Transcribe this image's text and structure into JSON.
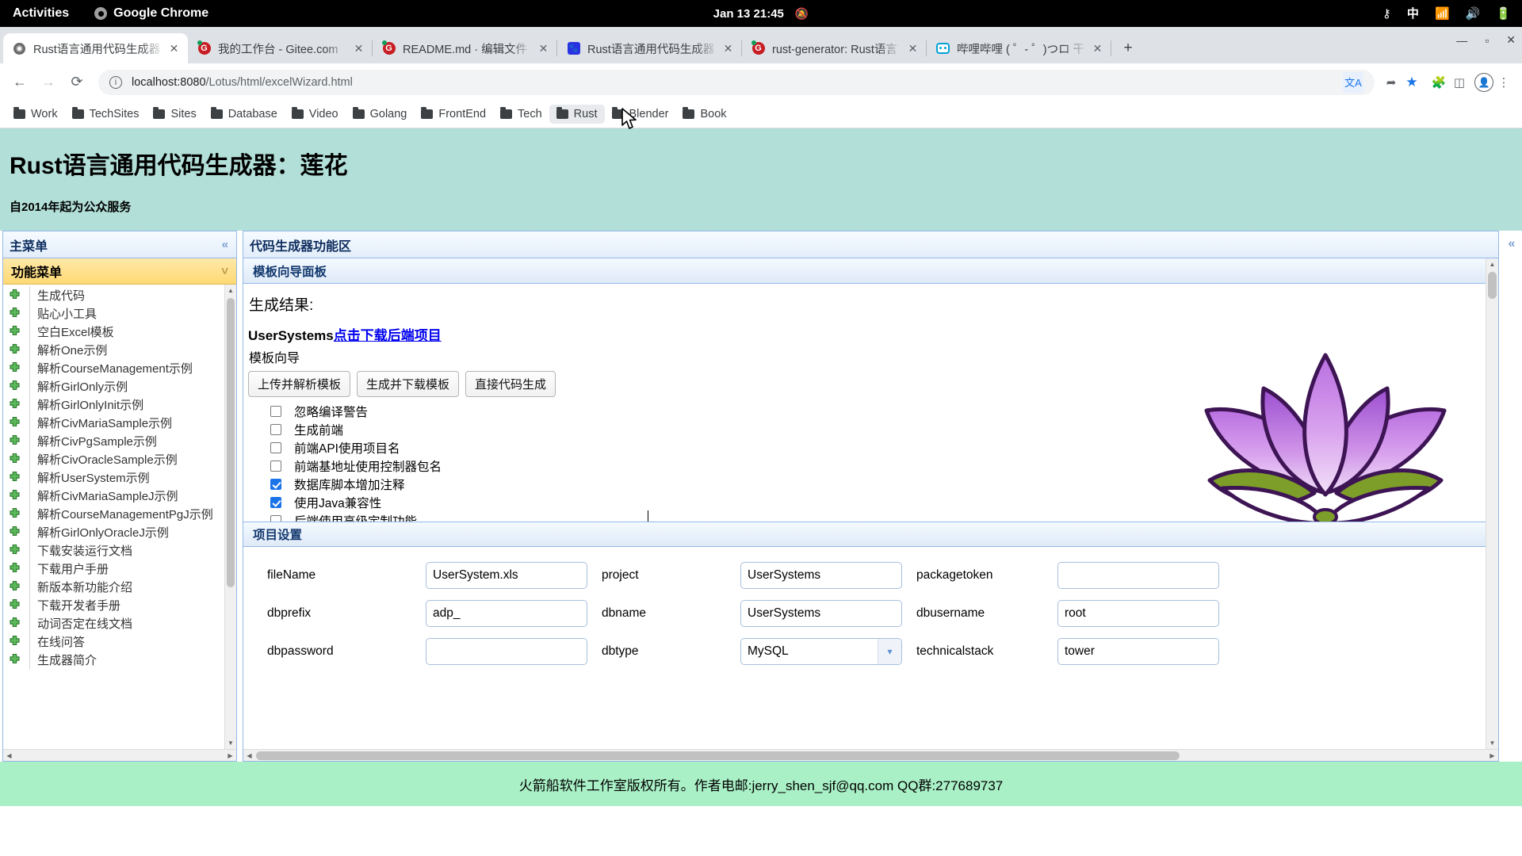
{
  "gnome": {
    "activities": "Activities",
    "app_name": "Google Chrome",
    "clock": "Jan 13  21:45",
    "notif_icon": "bell-muted-icon",
    "tray": {
      "accessibility": "accessibility-icon",
      "input_method": "中",
      "wifi": "wifi-icon",
      "volume": "volume-icon",
      "battery": "battery-charging-icon"
    }
  },
  "browser": {
    "tabs": [
      {
        "title": "Rust语言通用代码生成器",
        "favicon": "globe-icon",
        "active": true
      },
      {
        "title": "我的工作台 - Gitee.com",
        "favicon": "gitee-icon",
        "active": false
      },
      {
        "title": "README.md · 编辑文件",
        "favicon": "gitee-icon",
        "active": false
      },
      {
        "title": "Rust语言通用代码生成器",
        "favicon": "baidu-icon",
        "active": false
      },
      {
        "title": "rust-generator: Rust语言",
        "favicon": "gitee-icon",
        "active": false
      },
      {
        "title": "哔哩哔哩 ( ゜- ゜)つロ 干",
        "favicon": "bilibili-icon",
        "active": false
      }
    ],
    "new_tab_label": "+",
    "window_controls": {
      "minimize": "—",
      "maximize": "▫",
      "close": "✕"
    },
    "toolbar": {
      "back": "←",
      "forward": "→",
      "reload": "⟳",
      "url_host": "localhost:8080",
      "url_path": "/Lotus/html/excelWizard.html",
      "site_info_icon": "info-circle-icon",
      "translate_icon": "translate-icon",
      "share_icon": "share-icon",
      "bookmark_icon": "star-filled-icon",
      "extensions_icon": "puzzle-icon",
      "sidepanel_icon": "side-panel-icon",
      "profile_icon": "avatar-icon",
      "menu_icon": "three-dot-menu-icon"
    },
    "bookmarks": [
      {
        "label": "Work",
        "hovered": false
      },
      {
        "label": "TechSites",
        "hovered": false
      },
      {
        "label": "Sites",
        "hovered": false
      },
      {
        "label": "Database",
        "hovered": false
      },
      {
        "label": "Video",
        "hovered": false
      },
      {
        "label": "Golang",
        "hovered": false
      },
      {
        "label": "FrontEnd",
        "hovered": false
      },
      {
        "label": "Tech",
        "hovered": false
      },
      {
        "label": "Rust",
        "hovered": true
      },
      {
        "label": "Blender",
        "hovered": false
      },
      {
        "label": "Book",
        "hovered": false
      }
    ]
  },
  "page": {
    "title": "Rust语言通用代码生成器：莲花",
    "subtitle": "自2014年起为公众服务",
    "sidebar": {
      "header": "主菜单",
      "collapse_icon": "chevron-double-left-icon",
      "accordion_title": "功能菜单",
      "accordion_icon": "chevron-double-up-icon",
      "items": [
        "生成代码",
        "贴心小工具",
        "空白Excel模板",
        "解析One示例",
        "解析CourseManagement示例",
        "解析GirlOnly示例",
        "解析GirlOnlyInit示例",
        "解析CivMariaSample示例",
        "解析CivPgSample示例",
        "解析CivOracleSample示例",
        "解析UserSystem示例",
        "解析CivMariaSampleJ示例",
        "解析CourseManagementPgJ示例",
        "解析GirlOnlyOracleJ示例",
        "下载安装运行文档",
        "下载用户手册",
        "新版本新功能介绍",
        "下载开发者手册",
        "动词否定在线文档",
        "在线问答",
        "生成器简介"
      ]
    },
    "main": {
      "header": "代码生成器功能区",
      "wizard_panel_title": "模板向导面板",
      "gen_result_label": "生成结果:",
      "result_project": "UserSystems",
      "result_link": "点击下载后端项目",
      "wizard_label": "模板向导",
      "buttons": [
        "上传并解析模板",
        "生成并下载模板",
        "直接代码生成"
      ],
      "checkboxes": [
        {
          "label": "忽略编译警告",
          "checked": false
        },
        {
          "label": "生成前端",
          "checked": false
        },
        {
          "label": "前端API使用项目名",
          "checked": false
        },
        {
          "label": "前端基地址使用控制器包名",
          "checked": false
        },
        {
          "label": "数据库脚本增加注释",
          "checked": true
        },
        {
          "label": "使用Java兼容性",
          "checked": true
        },
        {
          "label": "后端使用高级定制功能",
          "checked": false
        }
      ],
      "settings_panel_title": "项目设置",
      "fields": [
        {
          "label": "fileName",
          "value": "UserSystem.xls",
          "type": "text"
        },
        {
          "label": "project",
          "value": "UserSystems",
          "type": "text"
        },
        {
          "label": "packagetoken",
          "value": "",
          "type": "text"
        },
        {
          "label": "dbprefix",
          "value": "adp_",
          "type": "text"
        },
        {
          "label": "dbname",
          "value": "UserSystems",
          "type": "text"
        },
        {
          "label": "dbusername",
          "value": "root",
          "type": "text"
        },
        {
          "label": "dbpassword",
          "value": "",
          "type": "text"
        },
        {
          "label": "dbtype",
          "value": "MySQL",
          "type": "select"
        },
        {
          "label": "technicalstack",
          "value": "tower",
          "type": "text"
        }
      ],
      "right_rail_icon": "chevron-double-left-icon"
    },
    "footer": "火箭船软件工作室版权所有。作者电邮:jerry_shen_sjf@qq.com QQ群:277689737"
  }
}
